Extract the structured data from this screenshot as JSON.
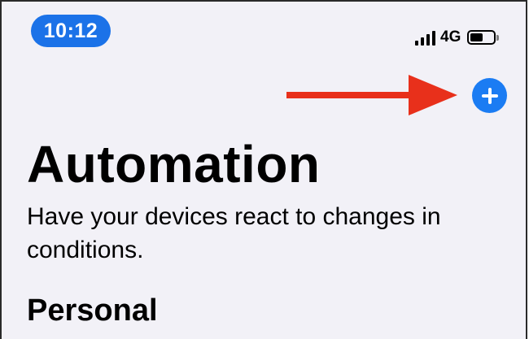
{
  "status_bar": {
    "time": "10:12",
    "network": "4G",
    "signal_bars": 4,
    "battery_level": 0.55,
    "icons": [
      "cellular-signal-icon",
      "battery-icon"
    ]
  },
  "toolbar": {
    "add_button_icon": "plus-icon",
    "annotation_icon": "red-arrow-icon"
  },
  "page": {
    "title": "Automation",
    "subtitle": "Have your devices react to changes in conditions.",
    "section_heading": "Personal"
  },
  "colors": {
    "background": "#f2f1f7",
    "accent_blue": "#1b7cf3",
    "time_pill_blue": "#1b72e8",
    "annotation_red": "#e8301b",
    "text": "#000000"
  }
}
